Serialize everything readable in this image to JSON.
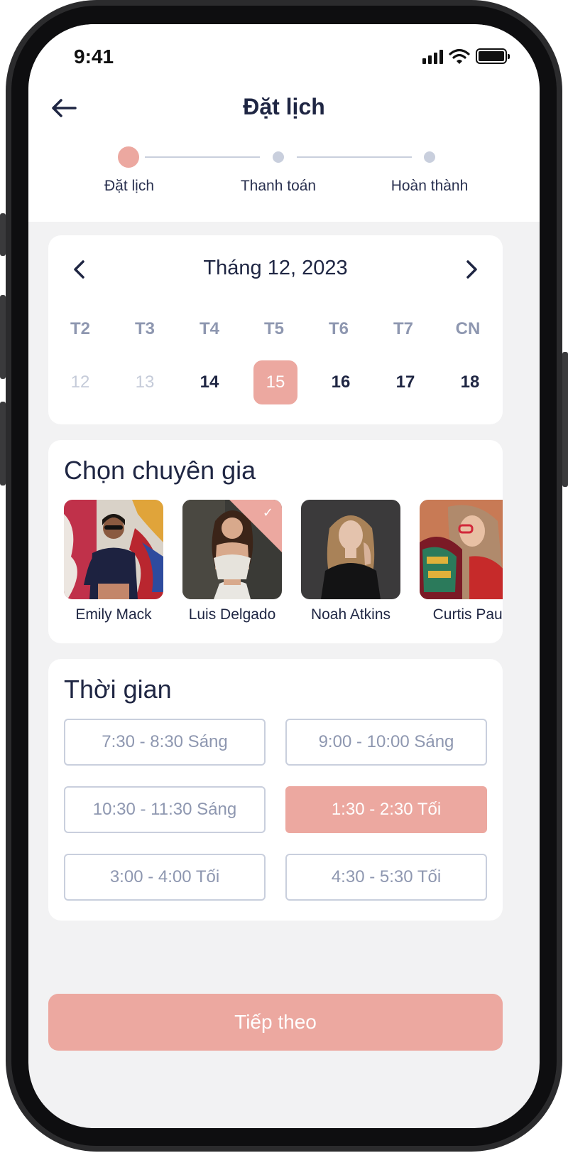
{
  "status": {
    "time": "9:41"
  },
  "header": {
    "title": "Đặt lịch"
  },
  "stepper": {
    "steps": [
      {
        "label": "Đặt lịch",
        "active": true
      },
      {
        "label": "Thanh toán",
        "active": false
      },
      {
        "label": "Hoàn thành",
        "active": false
      }
    ]
  },
  "calendar": {
    "month_label": "Tháng 12, 2023",
    "weekdays": [
      "T2",
      "T3",
      "T4",
      "T5",
      "T6",
      "T7",
      "CN"
    ],
    "days": [
      {
        "num": "12",
        "state": "disabled"
      },
      {
        "num": "13",
        "state": "disabled"
      },
      {
        "num": "14",
        "state": "normal"
      },
      {
        "num": "15",
        "state": "selected"
      },
      {
        "num": "16",
        "state": "normal"
      },
      {
        "num": "17",
        "state": "normal"
      },
      {
        "num": "18",
        "state": "normal"
      }
    ]
  },
  "experts": {
    "title": "Chọn chuyên gia",
    "items": [
      {
        "name": "Emily Mack",
        "selected": false
      },
      {
        "name": "Luis Delgado",
        "selected": true
      },
      {
        "name": "Noah Atkins",
        "selected": false
      },
      {
        "name": "Curtis Paul",
        "selected": false
      }
    ]
  },
  "time": {
    "title": "Thời gian",
    "slots": [
      {
        "label": "7:30 - 8:30 Sáng",
        "selected": false
      },
      {
        "label": "9:00 - 10:00 Sáng",
        "selected": false
      },
      {
        "label": "10:30 - 11:30 Sáng",
        "selected": false
      },
      {
        "label": "1:30 - 2:30 Tối",
        "selected": true
      },
      {
        "label": "3:00 - 4:00 Tối",
        "selected": false
      },
      {
        "label": "4:30 - 5:30 Tối",
        "selected": false
      }
    ]
  },
  "footer": {
    "next_label": "Tiếp theo"
  },
  "colors": {
    "accent": "#eca8a0",
    "text": "#1f2643",
    "muted": "#8e97b0",
    "inactive": "#c9cfdd",
    "background": "#f2f2f3"
  }
}
